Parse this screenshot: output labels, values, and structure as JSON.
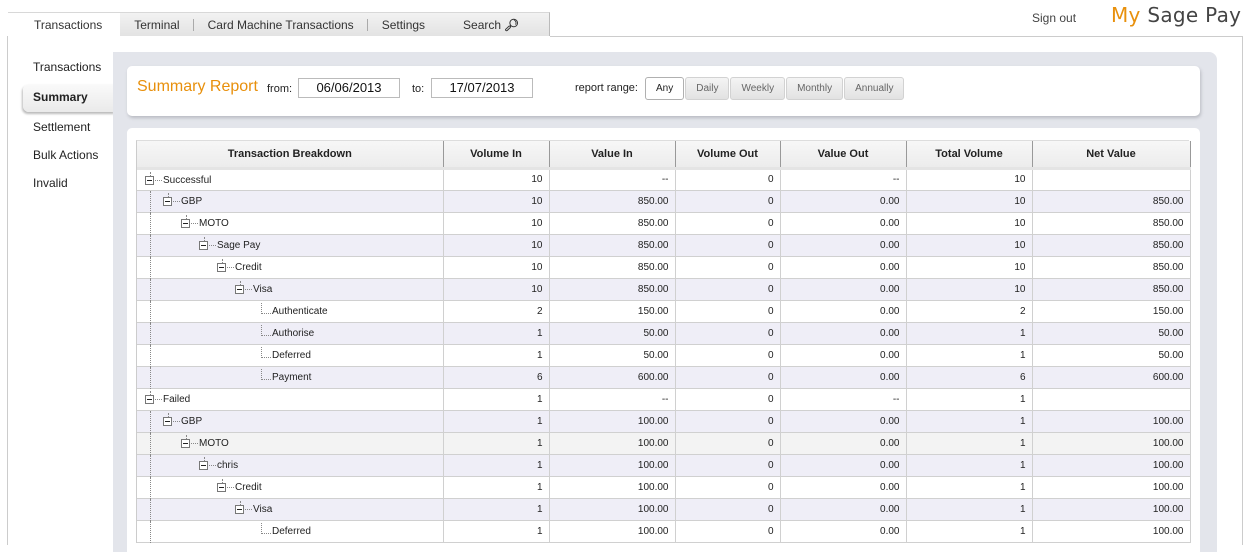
{
  "top_tabs": [
    {
      "label": "Transactions",
      "active": true
    },
    {
      "label": "Terminal"
    },
    {
      "label": "Card Machine Transactions"
    },
    {
      "label": "Settings"
    },
    {
      "label": "Search",
      "icon": "search-icon"
    }
  ],
  "header": {
    "sign_out": "Sign out",
    "brand_my": "My",
    "brand_rest": " Sage Pay"
  },
  "sidebar": {
    "items": [
      {
        "label": "Transactions"
      },
      {
        "label": "Summary",
        "active": true
      },
      {
        "label": "Settlement"
      },
      {
        "label": "Bulk Actions"
      },
      {
        "label": "Invalid"
      }
    ]
  },
  "report": {
    "title": "Summary Report",
    "from_label": "from:",
    "from_value": "06/06/2013",
    "to_label": "to:",
    "to_value": "17/07/2013",
    "range_label": "report range:",
    "ranges": [
      "Any",
      "Daily",
      "Weekly",
      "Monthly",
      "Annually"
    ],
    "active_range": "Any"
  },
  "colors": {
    "accent": "#e8900c",
    "row_alt": "#efeef7"
  },
  "table": {
    "columns": [
      "Transaction Breakdown",
      "Volume In",
      "Value In",
      "Volume Out",
      "Value Out",
      "Total Volume",
      "Net Value"
    ],
    "rows": [
      {
        "label": "Successful",
        "level": 0,
        "type": "node",
        "cells": [
          "10",
          "--",
          "0",
          "--",
          "10",
          ""
        ]
      },
      {
        "label": "GBP",
        "level": 1,
        "type": "node",
        "cells": [
          "10",
          "850.00",
          "0",
          "0.00",
          "10",
          "850.00"
        ]
      },
      {
        "label": "MOTO",
        "level": 2,
        "type": "node",
        "cells": [
          "10",
          "850.00",
          "0",
          "0.00",
          "10",
          "850.00"
        ]
      },
      {
        "label": "Sage Pay",
        "level": 3,
        "type": "node",
        "cells": [
          "10",
          "850.00",
          "0",
          "0.00",
          "10",
          "850.00"
        ]
      },
      {
        "label": "Credit",
        "level": 4,
        "type": "node",
        "cells": [
          "10",
          "850.00",
          "0",
          "0.00",
          "10",
          "850.00"
        ]
      },
      {
        "label": "Visa",
        "level": 5,
        "type": "node",
        "cells": [
          "10",
          "850.00",
          "0",
          "0.00",
          "10",
          "850.00"
        ]
      },
      {
        "label": "Authenticate",
        "level": 6,
        "type": "leaf",
        "cells": [
          "2",
          "150.00",
          "0",
          "0.00",
          "2",
          "150.00"
        ]
      },
      {
        "label": "Authorise",
        "level": 6,
        "type": "leaf",
        "cells": [
          "1",
          "50.00",
          "0",
          "0.00",
          "1",
          "50.00"
        ]
      },
      {
        "label": "Deferred",
        "level": 6,
        "type": "leaf",
        "cells": [
          "1",
          "50.00",
          "0",
          "0.00",
          "1",
          "50.00"
        ]
      },
      {
        "label": "Payment",
        "level": 6,
        "type": "leaf",
        "cells": [
          "6",
          "600.00",
          "0",
          "0.00",
          "6",
          "600.00"
        ]
      },
      {
        "label": "Failed",
        "level": 0,
        "type": "node",
        "cells": [
          "1",
          "--",
          "0",
          "--",
          "1",
          ""
        ]
      },
      {
        "label": "GBP",
        "level": 1,
        "type": "node",
        "cells": [
          "1",
          "100.00",
          "0",
          "0.00",
          "1",
          "100.00"
        ]
      },
      {
        "label": "MOTO",
        "level": 2,
        "type": "node",
        "hover": true,
        "cells": [
          "1",
          "100.00",
          "0",
          "0.00",
          "1",
          "100.00"
        ]
      },
      {
        "label": "chris",
        "level": 3,
        "type": "node",
        "cells": [
          "1",
          "100.00",
          "0",
          "0.00",
          "1",
          "100.00"
        ]
      },
      {
        "label": "Credit",
        "level": 4,
        "type": "node",
        "cells": [
          "1",
          "100.00",
          "0",
          "0.00",
          "1",
          "100.00"
        ]
      },
      {
        "label": "Visa",
        "level": 5,
        "type": "node",
        "cells": [
          "1",
          "100.00",
          "0",
          "0.00",
          "1",
          "100.00"
        ]
      },
      {
        "label": "Deferred",
        "level": 6,
        "type": "leaf",
        "cells": [
          "1",
          "100.00",
          "0",
          "0.00",
          "1",
          "100.00"
        ]
      }
    ]
  }
}
